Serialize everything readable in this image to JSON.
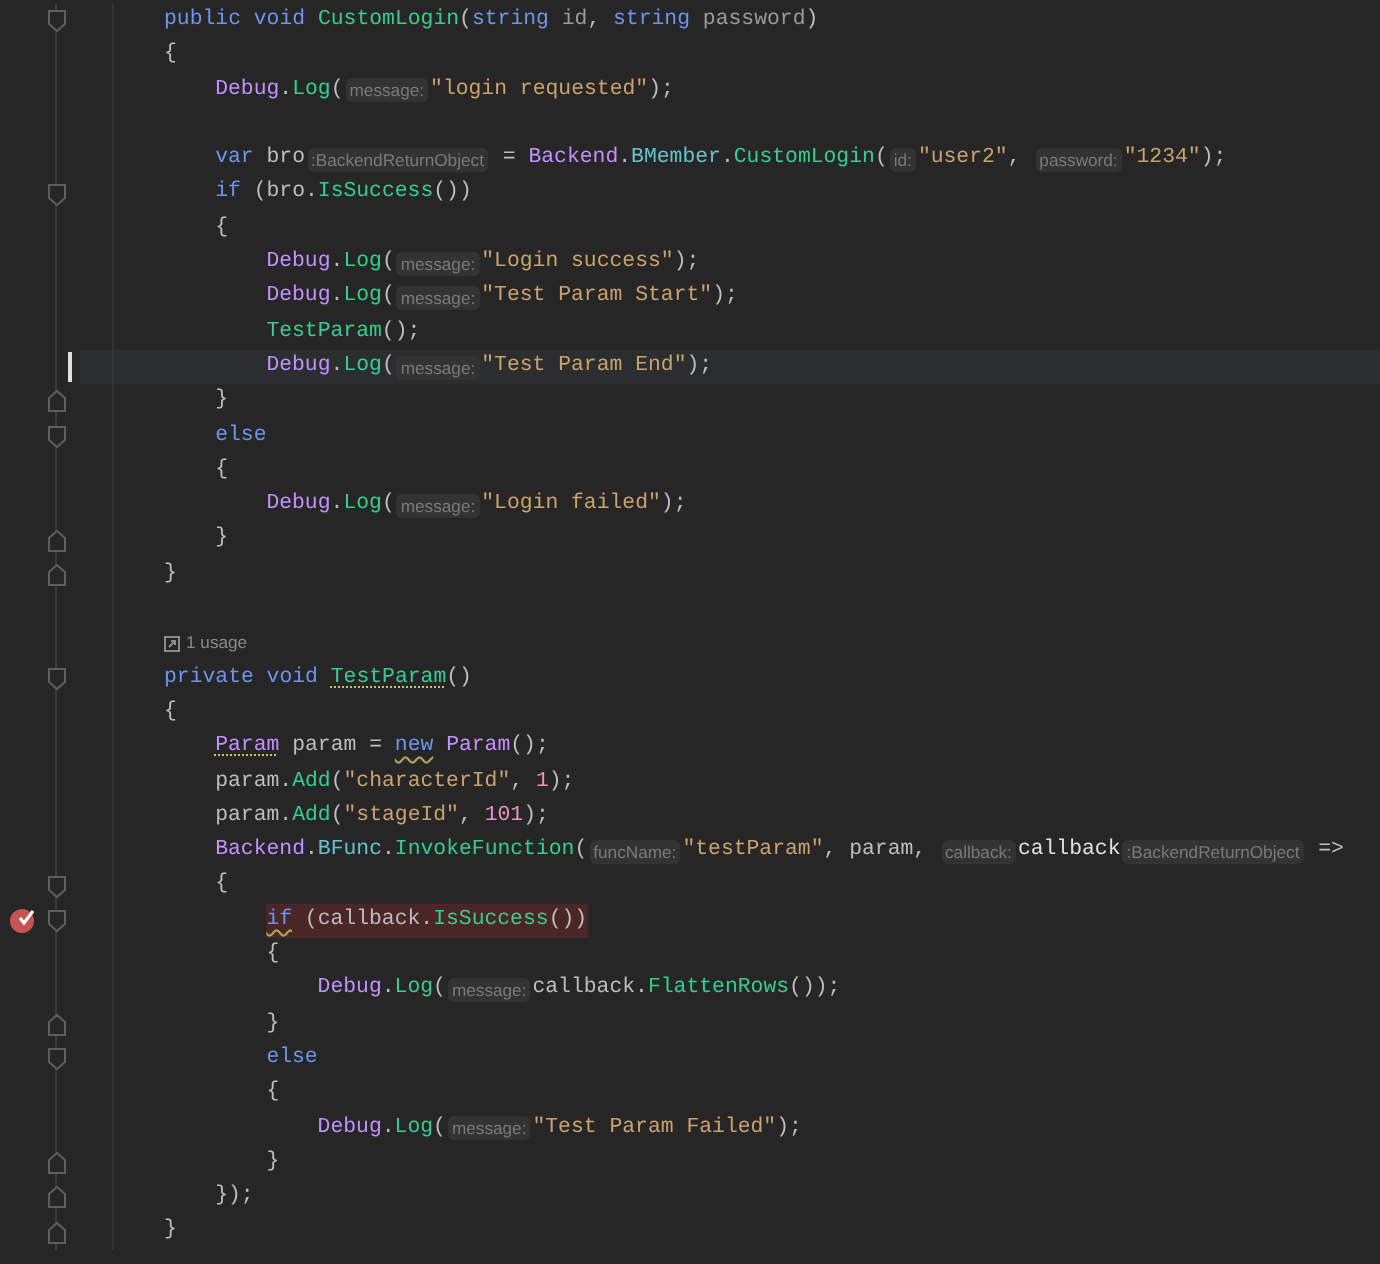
{
  "editor": {
    "lines": [
      {
        "kind": "code",
        "fold_start": true,
        "tokens": [
          {
            "kind": "keyword",
            "text": "public void "
          },
          {
            "kind": "method",
            "text": "CustomLogin"
          },
          {
            "kind": "plain",
            "text": "("
          },
          {
            "kind": "keyword",
            "text": "string "
          },
          {
            "kind": "param",
            "text": "id"
          },
          {
            "kind": "plain",
            "text": ", "
          },
          {
            "kind": "keyword",
            "text": "string "
          },
          {
            "kind": "param",
            "text": "password"
          },
          {
            "kind": "plain",
            "text": ")"
          }
        ]
      },
      {
        "kind": "code",
        "tokens": [
          {
            "kind": "plain",
            "text": "{"
          }
        ],
        "children": [
          {
            "kind": "code",
            "tokens": [
              {
                "kind": "type",
                "text": "Debug"
              },
              {
                "kind": "plain",
                "text": "."
              },
              {
                "kind": "method",
                "text": "Log"
              },
              {
                "kind": "plain",
                "text": "("
              },
              {
                "kind": "hint",
                "text": "message:"
              },
              {
                "kind": "string",
                "text": "\"login requested\""
              },
              {
                "kind": "plain",
                "text": ");"
              }
            ]
          },
          {
            "kind": "blank"
          },
          {
            "kind": "code",
            "tokens": [
              {
                "kind": "keyword",
                "text": "var"
              },
              {
                "kind": "plain",
                "text": " bro"
              },
              {
                "kind": "hint",
                "text": ":BackendReturnObject"
              },
              {
                "kind": "plain",
                "text": " = "
              },
              {
                "kind": "type",
                "text": "Backend"
              },
              {
                "kind": "plain",
                "text": "."
              },
              {
                "kind": "member",
                "text": "BMember"
              },
              {
                "kind": "plain",
                "text": "."
              },
              {
                "kind": "method",
                "text": "CustomLogin"
              },
              {
                "kind": "plain",
                "text": "("
              },
              {
                "kind": "hint",
                "text": "id:"
              },
              {
                "kind": "string",
                "text": "\"user2\""
              },
              {
                "kind": "plain",
                "text": ", "
              },
              {
                "kind": "hint",
                "text": "password:"
              },
              {
                "kind": "string",
                "text": "\"1234\""
              },
              {
                "kind": "plain",
                "text": ");"
              }
            ]
          },
          {
            "kind": "code",
            "fold_start": true,
            "tokens": [
              {
                "kind": "keyword",
                "text": "if"
              },
              {
                "kind": "plain",
                "text": " (bro."
              },
              {
                "kind": "method",
                "text": "IsSuccess"
              },
              {
                "kind": "plain",
                "text": "())"
              }
            ]
          },
          {
            "kind": "code",
            "tokens": [
              {
                "kind": "plain",
                "text": "{"
              }
            ],
            "children": [
              {
                "kind": "code",
                "tokens": [
                  {
                    "kind": "type",
                    "text": "Debug"
                  },
                  {
                    "kind": "plain",
                    "text": "."
                  },
                  {
                    "kind": "method",
                    "text": "Log"
                  },
                  {
                    "kind": "plain",
                    "text": "("
                  },
                  {
                    "kind": "hint",
                    "text": "message:"
                  },
                  {
                    "kind": "string",
                    "text": "\"Login success\""
                  },
                  {
                    "kind": "plain",
                    "text": ");"
                  }
                ]
              },
              {
                "kind": "code",
                "tokens": [
                  {
                    "kind": "type",
                    "text": "Debug"
                  },
                  {
                    "kind": "plain",
                    "text": "."
                  },
                  {
                    "kind": "method",
                    "text": "Log"
                  },
                  {
                    "kind": "plain",
                    "text": "("
                  },
                  {
                    "kind": "hint",
                    "text": "message:"
                  },
                  {
                    "kind": "string",
                    "text": "\"Test Param Start\""
                  },
                  {
                    "kind": "plain",
                    "text": ");"
                  }
                ]
              },
              {
                "kind": "code",
                "tokens": [
                  {
                    "kind": "method",
                    "text": "TestParam"
                  },
                  {
                    "kind": "plain",
                    "text": "();"
                  }
                ]
              },
              {
                "kind": "code",
                "current": true,
                "tokens": [
                  {
                    "kind": "type",
                    "text": "Debug"
                  },
                  {
                    "kind": "plain",
                    "text": "."
                  },
                  {
                    "kind": "method",
                    "text": "Log"
                  },
                  {
                    "kind": "plain",
                    "text": "("
                  },
                  {
                    "kind": "hint",
                    "text": "message:"
                  },
                  {
                    "kind": "string",
                    "text": "\"Test Param End\""
                  },
                  {
                    "kind": "plain",
                    "text": ");"
                  }
                ]
              }
            ]
          },
          {
            "kind": "code",
            "fold_end": true,
            "tokens": [
              {
                "kind": "plain",
                "text": "}"
              }
            ]
          },
          {
            "kind": "code",
            "fold_start": true,
            "tokens": [
              {
                "kind": "keyword",
                "text": "else"
              }
            ]
          },
          {
            "kind": "code",
            "tokens": [
              {
                "kind": "plain",
                "text": "{"
              }
            ],
            "children": [
              {
                "kind": "code",
                "tokens": [
                  {
                    "kind": "type",
                    "text": "Debug"
                  },
                  {
                    "kind": "plain",
                    "text": "."
                  },
                  {
                    "kind": "method",
                    "text": "Log"
                  },
                  {
                    "kind": "plain",
                    "text": "("
                  },
                  {
                    "kind": "hint",
                    "text": "message:"
                  },
                  {
                    "kind": "string",
                    "text": "\"Login failed\""
                  },
                  {
                    "kind": "plain",
                    "text": ");"
                  }
                ]
              }
            ]
          },
          {
            "kind": "code",
            "fold_end": true,
            "tokens": [
              {
                "kind": "plain",
                "text": "}"
              }
            ]
          }
        ]
      },
      {
        "kind": "code",
        "fold_end": true,
        "tokens": [
          {
            "kind": "plain",
            "text": "}"
          }
        ]
      },
      {
        "kind": "blank"
      },
      {
        "kind": "usages",
        "text": "1 usage"
      },
      {
        "kind": "code",
        "fold_start": true,
        "tokens": [
          {
            "kind": "keyword",
            "text": "private void "
          },
          {
            "kind": "method",
            "text": "TestParam",
            "dotted_underline": true
          },
          {
            "kind": "plain",
            "text": "()"
          }
        ]
      },
      {
        "kind": "code",
        "tokens": [
          {
            "kind": "plain",
            "text": "{"
          }
        ],
        "children": [
          {
            "kind": "code",
            "tokens": [
              {
                "kind": "type",
                "text": "Param",
                "dotted_underline": true
              },
              {
                "kind": "plain",
                "text": " param = "
              },
              {
                "kind": "keyword",
                "text": "new",
                "wavy_underline": true
              },
              {
                "kind": "type",
                "text": " Param"
              },
              {
                "kind": "plain",
                "text": "();"
              }
            ]
          },
          {
            "kind": "code",
            "tokens": [
              {
                "kind": "plain",
                "text": "param."
              },
              {
                "kind": "method",
                "text": "Add"
              },
              {
                "kind": "plain",
                "text": "("
              },
              {
                "kind": "string",
                "text": "\"characterId\""
              },
              {
                "kind": "plain",
                "text": ", "
              },
              {
                "kind": "number",
                "text": "1"
              },
              {
                "kind": "plain",
                "text": ");"
              }
            ]
          },
          {
            "kind": "code",
            "tokens": [
              {
                "kind": "plain",
                "text": "param."
              },
              {
                "kind": "method",
                "text": "Add"
              },
              {
                "kind": "plain",
                "text": "("
              },
              {
                "kind": "string",
                "text": "\"stageId\""
              },
              {
                "kind": "plain",
                "text": ", "
              },
              {
                "kind": "number",
                "text": "101"
              },
              {
                "kind": "plain",
                "text": ");"
              }
            ]
          },
          {
            "kind": "code",
            "tokens": [
              {
                "kind": "type",
                "text": "Backend"
              },
              {
                "kind": "plain",
                "text": "."
              },
              {
                "kind": "member",
                "text": "BFunc"
              },
              {
                "kind": "plain",
                "text": "."
              },
              {
                "kind": "method",
                "text": "InvokeFunction"
              },
              {
                "kind": "plain",
                "text": "("
              },
              {
                "kind": "hint",
                "text": "funcName:"
              },
              {
                "kind": "string",
                "text": "\"testParam\""
              },
              {
                "kind": "plain",
                "text": ", param, "
              },
              {
                "kind": "hint",
                "text": "callback:"
              },
              {
                "kind": "lambda",
                "text": "callback"
              },
              {
                "kind": "hint",
                "text": ":BackendReturnObject"
              },
              {
                "kind": "plain",
                "text": " =>"
              }
            ]
          },
          {
            "kind": "code",
            "fold_start": true,
            "tokens": [
              {
                "kind": "plain",
                "text": "{"
              }
            ],
            "children": [
              {
                "kind": "code",
                "fold_start": true,
                "breakpoint": true,
                "error": true,
                "tokens": [
                  {
                    "kind": "keyword",
                    "text": "if",
                    "wavy_underline": true
                  },
                  {
                    "kind": "plain",
                    "text": " (callback."
                  },
                  {
                    "kind": "method",
                    "text": "IsSuccess"
                  },
                  {
                    "kind": "plain",
                    "text": "())"
                  }
                ]
              },
              {
                "kind": "code",
                "tokens": [
                  {
                    "kind": "plain",
                    "text": "{"
                  }
                ],
                "children": [
                  {
                    "kind": "code",
                    "tokens": [
                      {
                        "kind": "type",
                        "text": "Debug"
                      },
                      {
                        "kind": "plain",
                        "text": "."
                      },
                      {
                        "kind": "method",
                        "text": "Log"
                      },
                      {
                        "kind": "plain",
                        "text": "("
                      },
                      {
                        "kind": "hint",
                        "text": "message:"
                      },
                      {
                        "kind": "plain",
                        "text": "callback."
                      },
                      {
                        "kind": "method",
                        "text": "FlattenRows"
                      },
                      {
                        "kind": "plain",
                        "text": "());"
                      }
                    ]
                  }
                ]
              },
              {
                "kind": "code",
                "fold_end": true,
                "tokens": [
                  {
                    "kind": "plain",
                    "text": "}"
                  }
                ]
              },
              {
                "kind": "code",
                "fold_start": true,
                "tokens": [
                  {
                    "kind": "keyword",
                    "text": "else"
                  }
                ]
              },
              {
                "kind": "code",
                "tokens": [
                  {
                    "kind": "plain",
                    "text": "{"
                  }
                ],
                "children": [
                  {
                    "kind": "code",
                    "tokens": [
                      {
                        "kind": "type",
                        "text": "Debug"
                      },
                      {
                        "kind": "plain",
                        "text": "."
                      },
                      {
                        "kind": "method",
                        "text": "Log"
                      },
                      {
                        "kind": "plain",
                        "text": "("
                      },
                      {
                        "kind": "hint",
                        "text": "message:"
                      },
                      {
                        "kind": "string",
                        "text": "\"Test Param Failed\""
                      },
                      {
                        "kind": "plain",
                        "text": ");"
                      }
                    ]
                  }
                ]
              },
              {
                "kind": "code",
                "fold_end": true,
                "tokens": [
                  {
                    "kind": "plain",
                    "text": "}"
                  }
                ]
              }
            ]
          },
          {
            "kind": "code",
            "fold_end": true,
            "tokens": [
              {
                "kind": "plain",
                "text": "});"
              }
            ]
          }
        ]
      },
      {
        "kind": "code",
        "fold_end": true,
        "tokens": [
          {
            "kind": "plain",
            "text": "}"
          }
        ]
      }
    ]
  }
}
